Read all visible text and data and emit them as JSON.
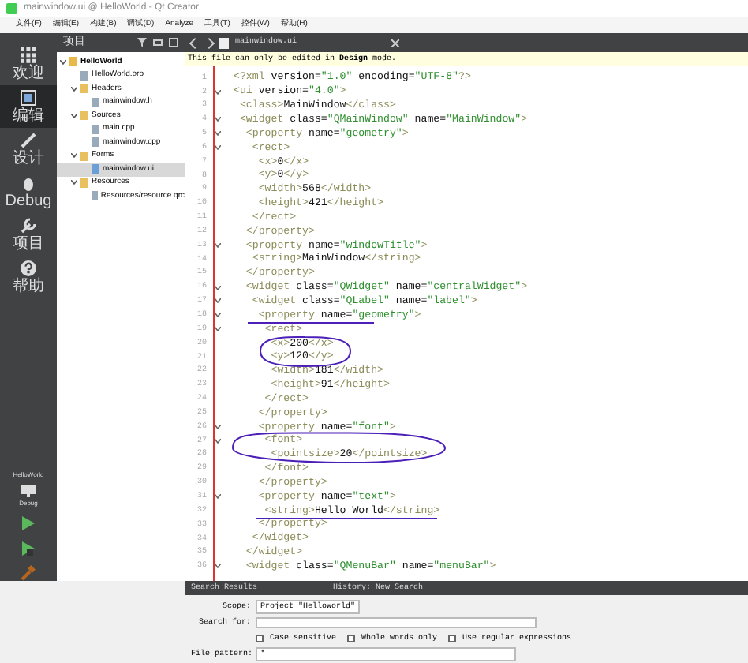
{
  "window": {
    "title": "mainwindow.ui @ HelloWorld - Qt Creator"
  },
  "menu": [
    "文件(F)",
    "编辑(E)",
    "构建(B)",
    "调试(D)",
    "Analyze",
    "工具(T)",
    "控件(W)",
    "帮助(H)"
  ],
  "modes": [
    {
      "label": "欢迎",
      "kind": "grid",
      "selected": false
    },
    {
      "label": "编辑",
      "kind": "edit",
      "selected": true
    },
    {
      "label": "设计",
      "kind": "pen",
      "selected": false
    },
    {
      "label": "Debug",
      "kind": "bug",
      "selected": false
    },
    {
      "label": "项目",
      "kind": "wrench",
      "selected": false
    },
    {
      "label": "帮助",
      "kind": "help",
      "selected": false
    }
  ],
  "kit": {
    "project": "HelloWorld",
    "config": "Debug"
  },
  "project_panel": {
    "title": "项目",
    "tree": [
      {
        "label": "HelloWorld",
        "kind": "project",
        "expanded": true,
        "children": [
          {
            "label": "HelloWorld.pro",
            "kind": "file"
          },
          {
            "label": "Headers",
            "kind": "folder",
            "expanded": true,
            "children": [
              {
                "label": "mainwindow.h",
                "kind": "file"
              }
            ]
          },
          {
            "label": "Sources",
            "kind": "folder",
            "expanded": true,
            "children": [
              {
                "label": "main.cpp",
                "kind": "file"
              },
              {
                "label": "mainwindow.cpp",
                "kind": "file"
              }
            ]
          },
          {
            "label": "Forms",
            "kind": "folder",
            "expanded": true,
            "children": [
              {
                "label": "mainwindow.ui",
                "kind": "form",
                "selected": true
              }
            ]
          },
          {
            "label": "Resources",
            "kind": "folder",
            "expanded": true,
            "children": [
              {
                "label": "Resources/resource.qrc",
                "kind": "file"
              }
            ]
          }
        ]
      }
    ]
  },
  "editor": {
    "tab": "mainwindow.ui",
    "banner": "This file can only be edited in **Design** mode.",
    "lines": [
      {
        "n": "1",
        "text": "<?xml version=\"1.0\" encoding=\"UTF-8\"?>",
        "foldable": false
      },
      {
        "n": "2",
        "text": "<ui version=\"4.0\">",
        "foldable": true
      },
      {
        "n": "3",
        "text": " <class>MainWindow</class>",
        "foldable": false
      },
      {
        "n": "4",
        "text": " <widget class=\"QMainWindow\" name=\"MainWindow\">",
        "foldable": true
      },
      {
        "n": "5",
        "text": "  <property name=\"geometry\">",
        "foldable": true
      },
      {
        "n": "6",
        "text": "   <rect>",
        "foldable": true
      },
      {
        "n": "7",
        "text": "    <x>0</x>",
        "foldable": false
      },
      {
        "n": "8",
        "text": "    <y>0</y>",
        "foldable": false
      },
      {
        "n": "9",
        "text": "    <width>568</width>",
        "foldable": false
      },
      {
        "n": "10",
        "text": "    <height>421</height>",
        "foldable": false
      },
      {
        "n": "11",
        "text": "   </rect>",
        "foldable": false
      },
      {
        "n": "12",
        "text": "  </property>",
        "foldable": false
      },
      {
        "n": "13",
        "text": "  <property name=\"windowTitle\">",
        "foldable": true
      },
      {
        "n": "14",
        "text": "   <string>MainWindow</string>",
        "foldable": false
      },
      {
        "n": "15",
        "text": "  </property>",
        "foldable": false
      },
      {
        "n": "16",
        "text": "  <widget class=\"QWidget\" name=\"centralWidget\">",
        "foldable": true
      },
      {
        "n": "17",
        "text": "   <widget class=\"QLabel\" name=\"label\">",
        "foldable": true
      },
      {
        "n": "18",
        "text": "    <property name=\"geometry\">",
        "foldable": true
      },
      {
        "n": "19",
        "text": "     <rect>",
        "foldable": true
      },
      {
        "n": "20",
        "text": "      <x>200</x>",
        "foldable": false
      },
      {
        "n": "21",
        "text": "      <y>120</y>",
        "foldable": false
      },
      {
        "n": "22",
        "text": "      <width>181</width>",
        "foldable": false
      },
      {
        "n": "23",
        "text": "      <height>91</height>",
        "foldable": false
      },
      {
        "n": "24",
        "text": "     </rect>",
        "foldable": false
      },
      {
        "n": "25",
        "text": "    </property>",
        "foldable": false
      },
      {
        "n": "26",
        "text": "    <property name=\"font\">",
        "foldable": true
      },
      {
        "n": "27",
        "text": "     <font>",
        "foldable": true
      },
      {
        "n": "28",
        "text": "      <pointsize>20</pointsize>",
        "foldable": false
      },
      {
        "n": "29",
        "text": "     </font>",
        "foldable": false
      },
      {
        "n": "30",
        "text": "    </property>",
        "foldable": false
      },
      {
        "n": "31",
        "text": "    <property name=\"text\">",
        "foldable": true
      },
      {
        "n": "32",
        "text": "     <string>Hello World</string>",
        "foldable": false
      },
      {
        "n": "33",
        "text": "    </property>",
        "foldable": false
      },
      {
        "n": "34",
        "text": "   </widget>",
        "foldable": false
      },
      {
        "n": "35",
        "text": "  </widget>",
        "foldable": false
      },
      {
        "n": "36",
        "text": "  <widget class=\"QMenuBar\" name=\"menuBar\">",
        "foldable": true
      }
    ]
  },
  "search_panel": {
    "title": "Search Results",
    "history": "History: New Search",
    "scope_label": "Scope:",
    "scope": "Project \"HelloWorld\"",
    "search_label": "Search for:",
    "options": [
      {
        "label": "Case sensitive",
        "checked": false
      },
      {
        "label": "Whole words only",
        "checked": false
      },
      {
        "label": "Use regular expressions",
        "checked": false
      }
    ],
    "pattern_label": "File pattern:",
    "pattern": "*"
  }
}
